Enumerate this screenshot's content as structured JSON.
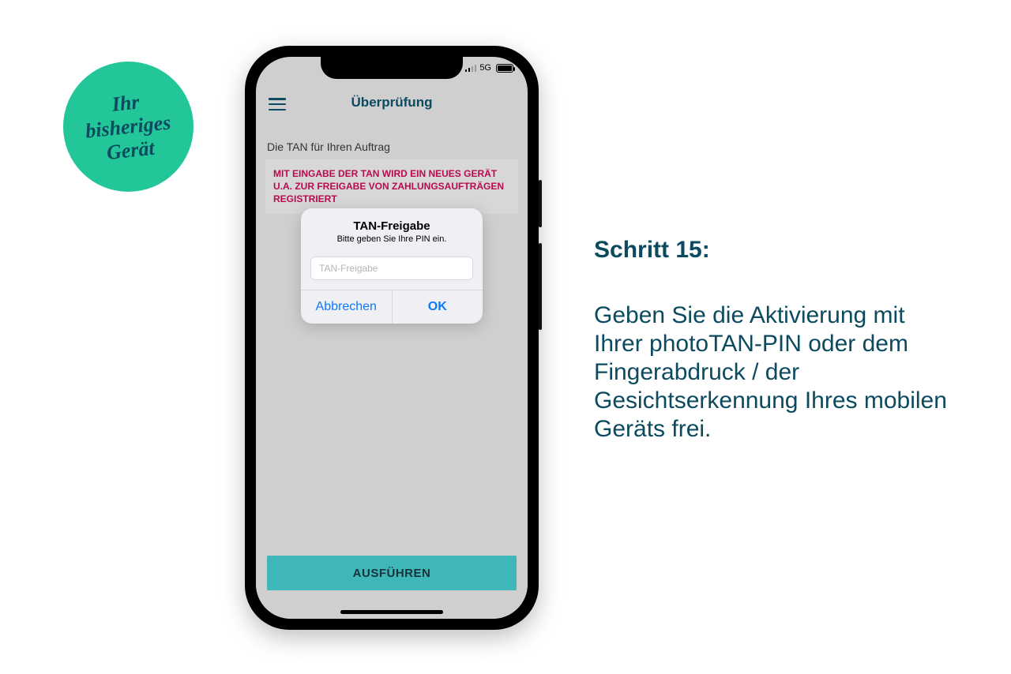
{
  "badge": {
    "line1": "Ihr",
    "line2": "bisheriges",
    "line3": "Gerät"
  },
  "statusbar": {
    "network": "5G"
  },
  "app": {
    "header_title": "Überprüfung",
    "tan_label": "Die TAN für Ihren Auftrag",
    "warning": "MIT EINGABE DER TAN WIRD EIN NEUES GERÄT U.A. ZUR FREIGABE VON ZAHLUNGSAUFTRÄGEN REGISTRIERT",
    "execute_label": "AUSFÜHREN"
  },
  "dialog": {
    "title": "TAN-Freigabe",
    "subtitle": "Bitte geben Sie Ihre PIN ein.",
    "placeholder": "TAN-Freigabe",
    "cancel": "Abbrechen",
    "ok": "OK"
  },
  "instruction": {
    "heading": "Schritt 15:",
    "body": "Geben Sie die Aktivierung mit Ihrer photoTAN-PIN oder dem Fingerabdruck / der Gesichtserkennung Ihres mobilen Geräts frei."
  }
}
